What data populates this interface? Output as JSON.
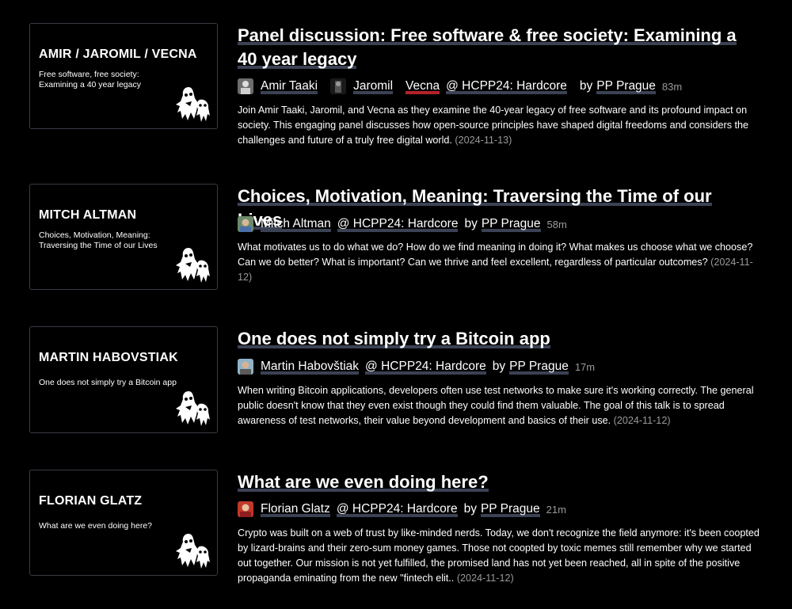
{
  "entries": [
    {
      "thumb_name": "AMIR / JAROMIL / VECNA",
      "thumb_subtitle": "Free software, free society: Examining a 40 year legacy",
      "title": "Panel discussion: Free software & free society: Examining a 40 year legacy",
      "speakers": [
        "Amir Taaki",
        "Jaromil",
        "Vecna"
      ],
      "event": "@ HCPP24: Hardcore",
      "by_label": "by",
      "channel": "PP Prague",
      "duration": "83m",
      "description": "Join Amir Taaki, Jaromil, and Vecna as they examine the 40-year legacy of free software and its profound impact on society. This engaging panel discusses how open-source principles have shaped digital freedoms and considers the challenges and future of a truly free digital world.",
      "date": "(2024-11-13)"
    },
    {
      "thumb_name": "MITCH ALTMAN",
      "thumb_subtitle": "Choices, Motivation, Meaning: Traversing the Time of our Lives",
      "title": "Choices, Motivation, Meaning: Traversing the Time of our Lives",
      "speakers": [
        "Mitch Altman"
      ],
      "event": "@ HCPP24: Hardcore",
      "by_label": "by",
      "channel": "PP Prague",
      "duration": "58m",
      "description": "What motivates us to do what we do? How do we find meaning in doing it? What makes us choose what we choose? Can we do better? What is important? Can we thrive and feel excellent, regardless of particular outcomes?",
      "date": "(2024-11-12)"
    },
    {
      "thumb_name": "MARTIN HABOVSTIAK",
      "thumb_subtitle": "One does not simply try a Bitcoin app",
      "title": "One does not simply try a Bitcoin app",
      "speakers": [
        "Martin Habovštiak"
      ],
      "event": "@ HCPP24: Hardcore",
      "by_label": "by",
      "channel": "PP Prague",
      "duration": "17m",
      "description": "When writing Bitcoin applications, developers often use test networks to make sure it's working correctly. The general public doesn't know that they even exist though they could find them valuable. The goal of this talk is to spread awareness of test networks, their value beyond development and basics of their use.",
      "date": "(2024-11-12)"
    },
    {
      "thumb_name": "FLORIAN GLATZ",
      "thumb_subtitle": "What are we even doing here?",
      "title": "What are we even doing here?",
      "speakers": [
        "Florian Glatz"
      ],
      "event": "@ HCPP24: Hardcore",
      "by_label": "by",
      "channel": "PP Prague",
      "duration": "21m",
      "description": "Crypto was built on a web of trust by like-minded nerds. Today, we don't recognize the field anymore: it's been coopted by lizard-brains and their zero-sum money games. Those not coopted by toxic memes still remember why we started out together. Our mission is not yet fulfilled, the promised land has not yet been reached, all in spite of the positive propaganda eminating from the new \"fintech elit..",
      "date": "(2024-11-12)"
    }
  ],
  "colors": {
    "underline": "#3b4254",
    "underline_red": "#b3222a",
    "muted": "#9a9a9a",
    "border": "#3a3a44"
  }
}
